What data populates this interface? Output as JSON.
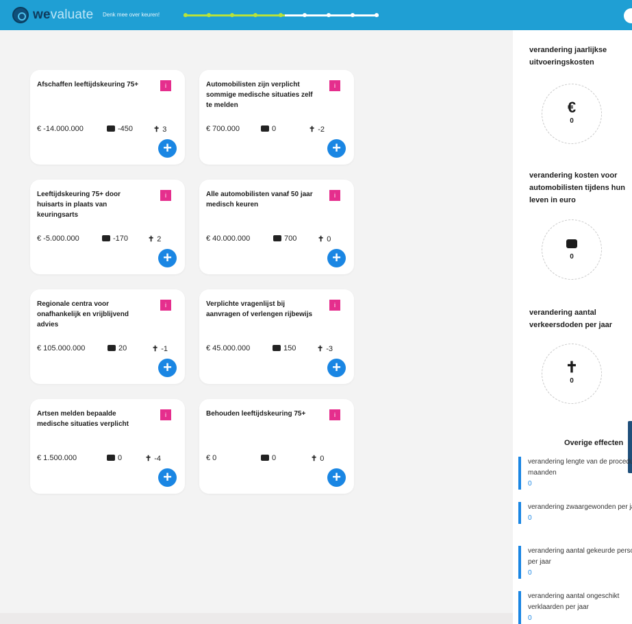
{
  "header": {
    "brand_bold": "we",
    "brand_light": "valuate",
    "tagline": "Denk mee over keuren!",
    "progress_fraction": 0.52
  },
  "cards": [
    {
      "title": "Afschaffen leeftijdskeuring 75+",
      "info": "i",
      "cost": "€ -14.000.000",
      "wallet": "-450",
      "deaths": "3",
      "add": "+"
    },
    {
      "title": "Automobilisten zijn verplicht sommige medische situaties zelf te melden",
      "info": "i",
      "cost": "€ 700.000",
      "wallet": "0",
      "deaths": "-2",
      "add": "+"
    },
    {
      "title": "Leeftijdskeuring 75+ door huisarts in plaats van keuringsarts",
      "info": "i",
      "cost": "€ -5.000.000",
      "wallet": "-170",
      "deaths": "2",
      "add": "+"
    },
    {
      "title": "Alle automobilisten vanaf 50 jaar medisch keuren",
      "info": "i",
      "cost": "€ 40.000.000",
      "wallet": "700",
      "deaths": "0",
      "add": "+"
    },
    {
      "title": "Regionale centra voor onafhankelijk en vrijblijvend advies",
      "info": "i",
      "cost": "€ 105.000.000",
      "wallet": "20",
      "deaths": "-1",
      "add": "+"
    },
    {
      "title": "Verplichte vragenlijst bij aanvragen of verlengen rijbewijs",
      "info": "i",
      "cost": "€ 45.000.000",
      "wallet": "150",
      "deaths": "-3",
      "add": "+"
    },
    {
      "title": "Artsen melden bepaalde medische situaties verplicht",
      "info": "i",
      "cost": "€ 1.500.000",
      "wallet": "0",
      "deaths": "-4",
      "add": "+"
    },
    {
      "title": "Behouden leeftijdskeuring 75+",
      "info": "i",
      "cost": "€ 0",
      "wallet": "0",
      "deaths": "0",
      "add": "+"
    }
  ],
  "panel": {
    "costs_title": "verandering jaarlijkse uitvoeringskosten",
    "costs_symbol": "€",
    "costs_value": "0",
    "motorist_title": "verandering kosten voor automobilisten tijdens hun leven in euro",
    "motorist_value": "0",
    "deaths_title": "verandering aantal verkeersdoden per jaar",
    "deaths_symbol": "✝",
    "deaths_value": "0",
    "other_title": "Overige effecten",
    "effects": [
      {
        "label": "verandering lengte van de procedure in maanden",
        "value": "0"
      },
      {
        "label": "verandering zwaargewonden per jaar",
        "value": "0"
      },
      {
        "label": "verandering aantal gekeurde personen per jaar",
        "value": "0"
      },
      {
        "label": "verandering aantal ongeschikt verklaarden per jaar",
        "value": "0"
      }
    ]
  }
}
